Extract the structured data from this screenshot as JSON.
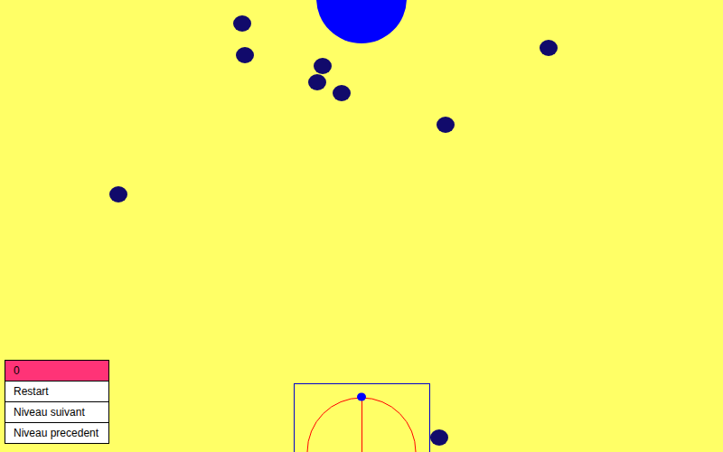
{
  "game": {
    "target": "large-blue-circle",
    "launcher": {
      "aim": "up"
    }
  },
  "menu": [
    {
      "label": "0",
      "highlighted": true
    },
    {
      "label": "Restart",
      "highlighted": false
    },
    {
      "label": "Niveau suivant",
      "highlighted": false
    },
    {
      "label": "Niveau precedent",
      "highlighted": false
    }
  ]
}
